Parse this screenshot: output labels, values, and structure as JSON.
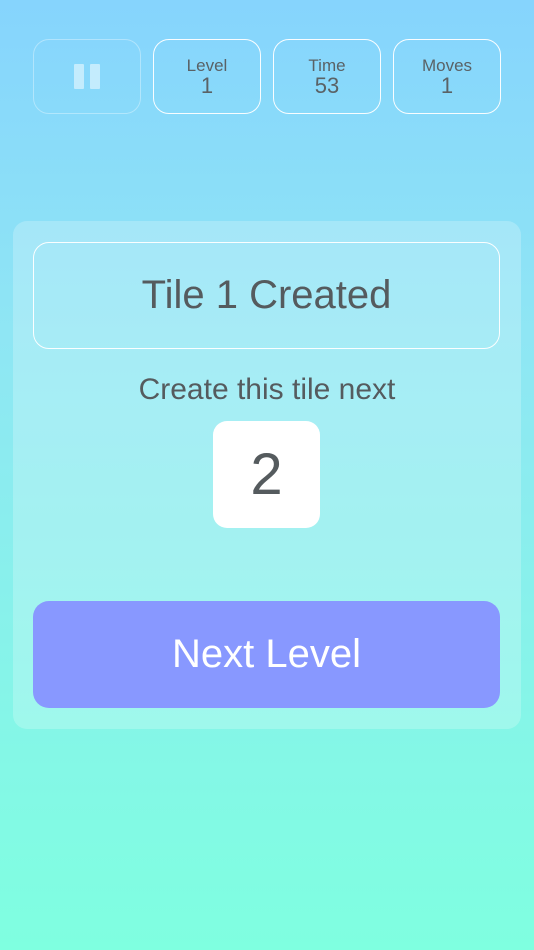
{
  "hud": {
    "pause_icon": "pause-icon",
    "level_label": "Level",
    "level_value": "1",
    "time_label": "Time",
    "time_value": "53",
    "moves_label": "Moves",
    "moves_value": "1"
  },
  "panel": {
    "message": "Tile 1 Created",
    "next_label": "Create this tile next",
    "next_tile": "2",
    "next_button": "Next Level"
  },
  "colors": {
    "button": "#8898ff",
    "tile": "#ffffff",
    "text": "#555b5e"
  }
}
